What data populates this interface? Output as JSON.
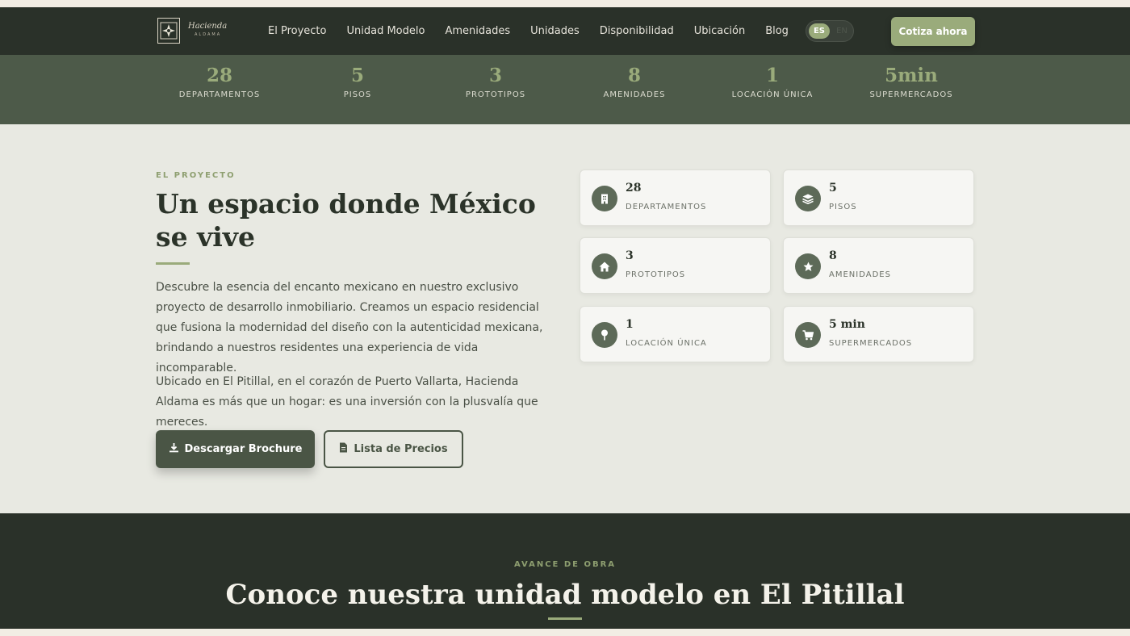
{
  "brand": {
    "name": "Hacienda",
    "sub": "ALDAMA"
  },
  "nav": {
    "links": [
      "El Proyecto",
      "Unidad Modelo",
      "Amenidades",
      "Unidades",
      "Disponibilidad",
      "Ubicación",
      "Blog"
    ],
    "lang_active": "ES",
    "lang_inactive": "EN",
    "cta": "Cotiza ahora"
  },
  "stats": [
    {
      "num": "28",
      "label": "DEPARTAMENTOS"
    },
    {
      "num": "5",
      "label": "PISOS"
    },
    {
      "num": "3",
      "label": "PROTOTIPOS"
    },
    {
      "num": "8",
      "label": "AMENIDADES"
    },
    {
      "num": "1",
      "label": "LOCACIÓN ÚNICA"
    },
    {
      "num": "5min",
      "label": "SUPERMERCADOS"
    }
  ],
  "project": {
    "eyebrow": "EL PROYECTO",
    "title": "Un espacio donde México se vive",
    "p1": "Descubre la esencia del encanto mexicano en nuestro exclusivo proyecto de desarrollo inmobiliario. Creamos un espacio residencial que fusiona la modernidad del diseño con la autenticidad mexicana, brindando a nuestros residentes una experiencia de vida incomparable.",
    "p2": "Ubicado en El Pitillal, en el corazón de Puerto Vallarta, Hacienda Aldama es más que un hogar: es una inversión con la plusvalía que mereces.",
    "btn_brochure": "Descargar Brochure",
    "btn_precios": "Lista de Precios",
    "cards": [
      {
        "num": "28",
        "label": "DEPARTAMENTOS",
        "icon": "building-icon"
      },
      {
        "num": "5",
        "label": "PISOS",
        "icon": "layers-icon"
      },
      {
        "num": "3",
        "label": "PROTOTIPOS",
        "icon": "home-icon"
      },
      {
        "num": "8",
        "label": "AMENIDADES",
        "icon": "star-icon"
      },
      {
        "num": "1",
        "label": "LOCACIÓN ÚNICA",
        "icon": "map-pin-icon"
      },
      {
        "num": "5 min",
        "label": "SUPERMERCADOS",
        "icon": "cart-icon"
      }
    ]
  },
  "avance": {
    "eyebrow": "AVANCE DE OBRA",
    "title": "Conoce nuestra unidad modelo en El Pitillal"
  },
  "colors": {
    "dark": "#2a3129",
    "olive": "#4d5a49",
    "accent": "#9aab7b",
    "bg_light": "#e8e9e2",
    "button_dark": "#4a5545"
  }
}
